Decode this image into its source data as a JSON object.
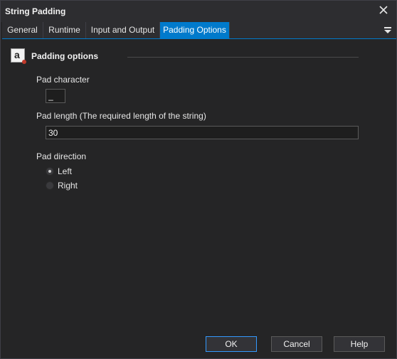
{
  "window": {
    "title": "String Padding"
  },
  "tabs": [
    {
      "label": "General"
    },
    {
      "label": "Runtime"
    },
    {
      "label": "Input and Output"
    },
    {
      "label": "Padding Options"
    }
  ],
  "section": {
    "title": "Padding options",
    "icon_letter": "a"
  },
  "fields": {
    "pad_character": {
      "label": "Pad character",
      "value": "_"
    },
    "pad_length": {
      "label": "Pad length (The required length of the string)",
      "value": "30"
    },
    "pad_direction": {
      "label": "Pad direction",
      "options": [
        {
          "label": "Left",
          "checked": true
        },
        {
          "label": "Right",
          "checked": false
        }
      ]
    }
  },
  "buttons": {
    "ok": "OK",
    "cancel": "Cancel",
    "help": "Help"
  },
  "colors": {
    "background": "#252526",
    "accent": "#007acc"
  }
}
